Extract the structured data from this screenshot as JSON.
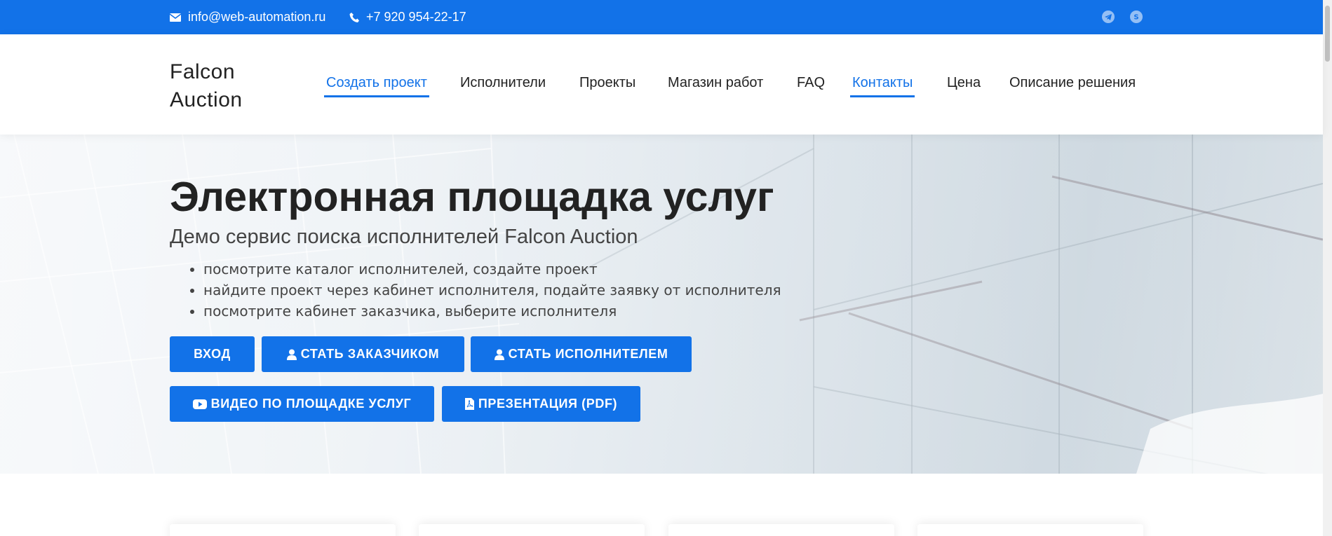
{
  "topbar": {
    "email": "info@web-automation.ru",
    "phone": "+7 920 954-22-17",
    "email_icon": "envelope-icon",
    "phone_icon": "phone-icon",
    "social": [
      "telegram-icon",
      "skype-icon"
    ]
  },
  "header": {
    "brand_line1": "Falcon",
    "brand_line2": "Auction",
    "nav": [
      {
        "label": "Создать проект",
        "active": true
      },
      {
        "label": "Исполнители",
        "active": false
      },
      {
        "label": "Проекты",
        "active": false
      },
      {
        "label": "Магазин работ",
        "active": false
      },
      {
        "label": "FAQ",
        "active": false
      },
      {
        "label": "Контакты",
        "active": true
      },
      {
        "label": "Цена",
        "active": false
      },
      {
        "label": "Описание решения",
        "active": false
      }
    ]
  },
  "hero": {
    "title": "Электронная площадка услуг",
    "subtitle": "Демо сервис поиска исполнителей Falcon Auction",
    "bullets": [
      "посмотрите каталог исполнителей, создайте проект",
      "найдите проект через кабинет исполнителя, подайте заявку от исполнителя",
      "посмотрите кабинет заказчика, выберите исполнителя"
    ],
    "buttons": {
      "login": "ВХОД",
      "customer": "СТАТЬ ЗАКАЗЧИКОМ",
      "contractor": "СТАТЬ ИСПОЛНИТЕЛЕМ",
      "video": "ВИДЕО ПО ПЛОЩАДКЕ УСЛУГ",
      "presentation": "ПРЕЗЕНТАЦИЯ (PDF)"
    }
  },
  "colors": {
    "accent": "#1272e8",
    "text": "#222222"
  }
}
